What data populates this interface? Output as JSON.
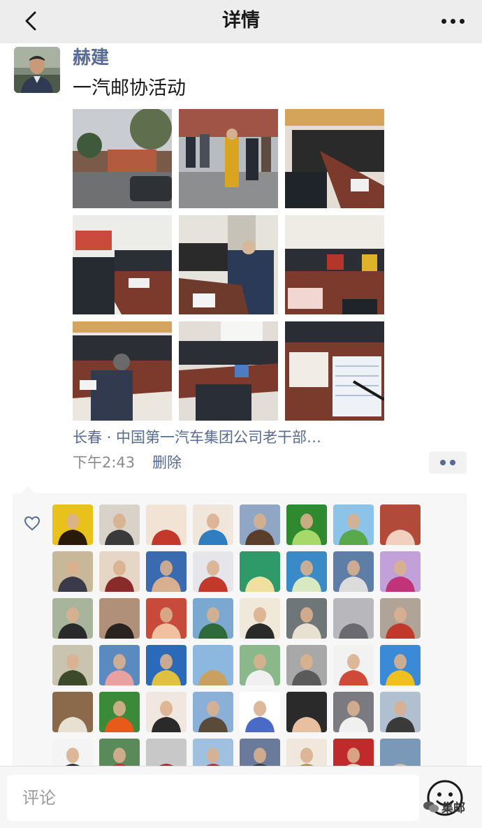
{
  "header": {
    "title": "详情",
    "back_icon": "chevron-left-icon",
    "more_icon": "more-dots-icon"
  },
  "post": {
    "author": "赫建",
    "text": "一汽邮协活动",
    "location": "长春 · 中国第一汽车集团公司老干部…",
    "time": "下午2:43",
    "delete_label": "删除",
    "photos": [
      {
        "name": "photo-building-street"
      },
      {
        "name": "photo-crowd-outdoor"
      },
      {
        "name": "photo-meeting-room-1"
      },
      {
        "name": "photo-meeting-room-2"
      },
      {
        "name": "photo-meeting-room-3"
      },
      {
        "name": "photo-meeting-room-4"
      },
      {
        "name": "photo-meeting-room-5"
      },
      {
        "name": "photo-meeting-room-6"
      },
      {
        "name": "photo-stamps-table"
      }
    ]
  },
  "likes": {
    "icon": "heart-outline-icon",
    "count_visible": 48
  },
  "footer": {
    "comment_placeholder": "评论",
    "emoji_icon": "emoji-face-icon",
    "watermark": "集邮"
  },
  "colors": {
    "link": "#576b95",
    "header_bg": "#ededed",
    "likes_bg": "#f7f7f7"
  }
}
